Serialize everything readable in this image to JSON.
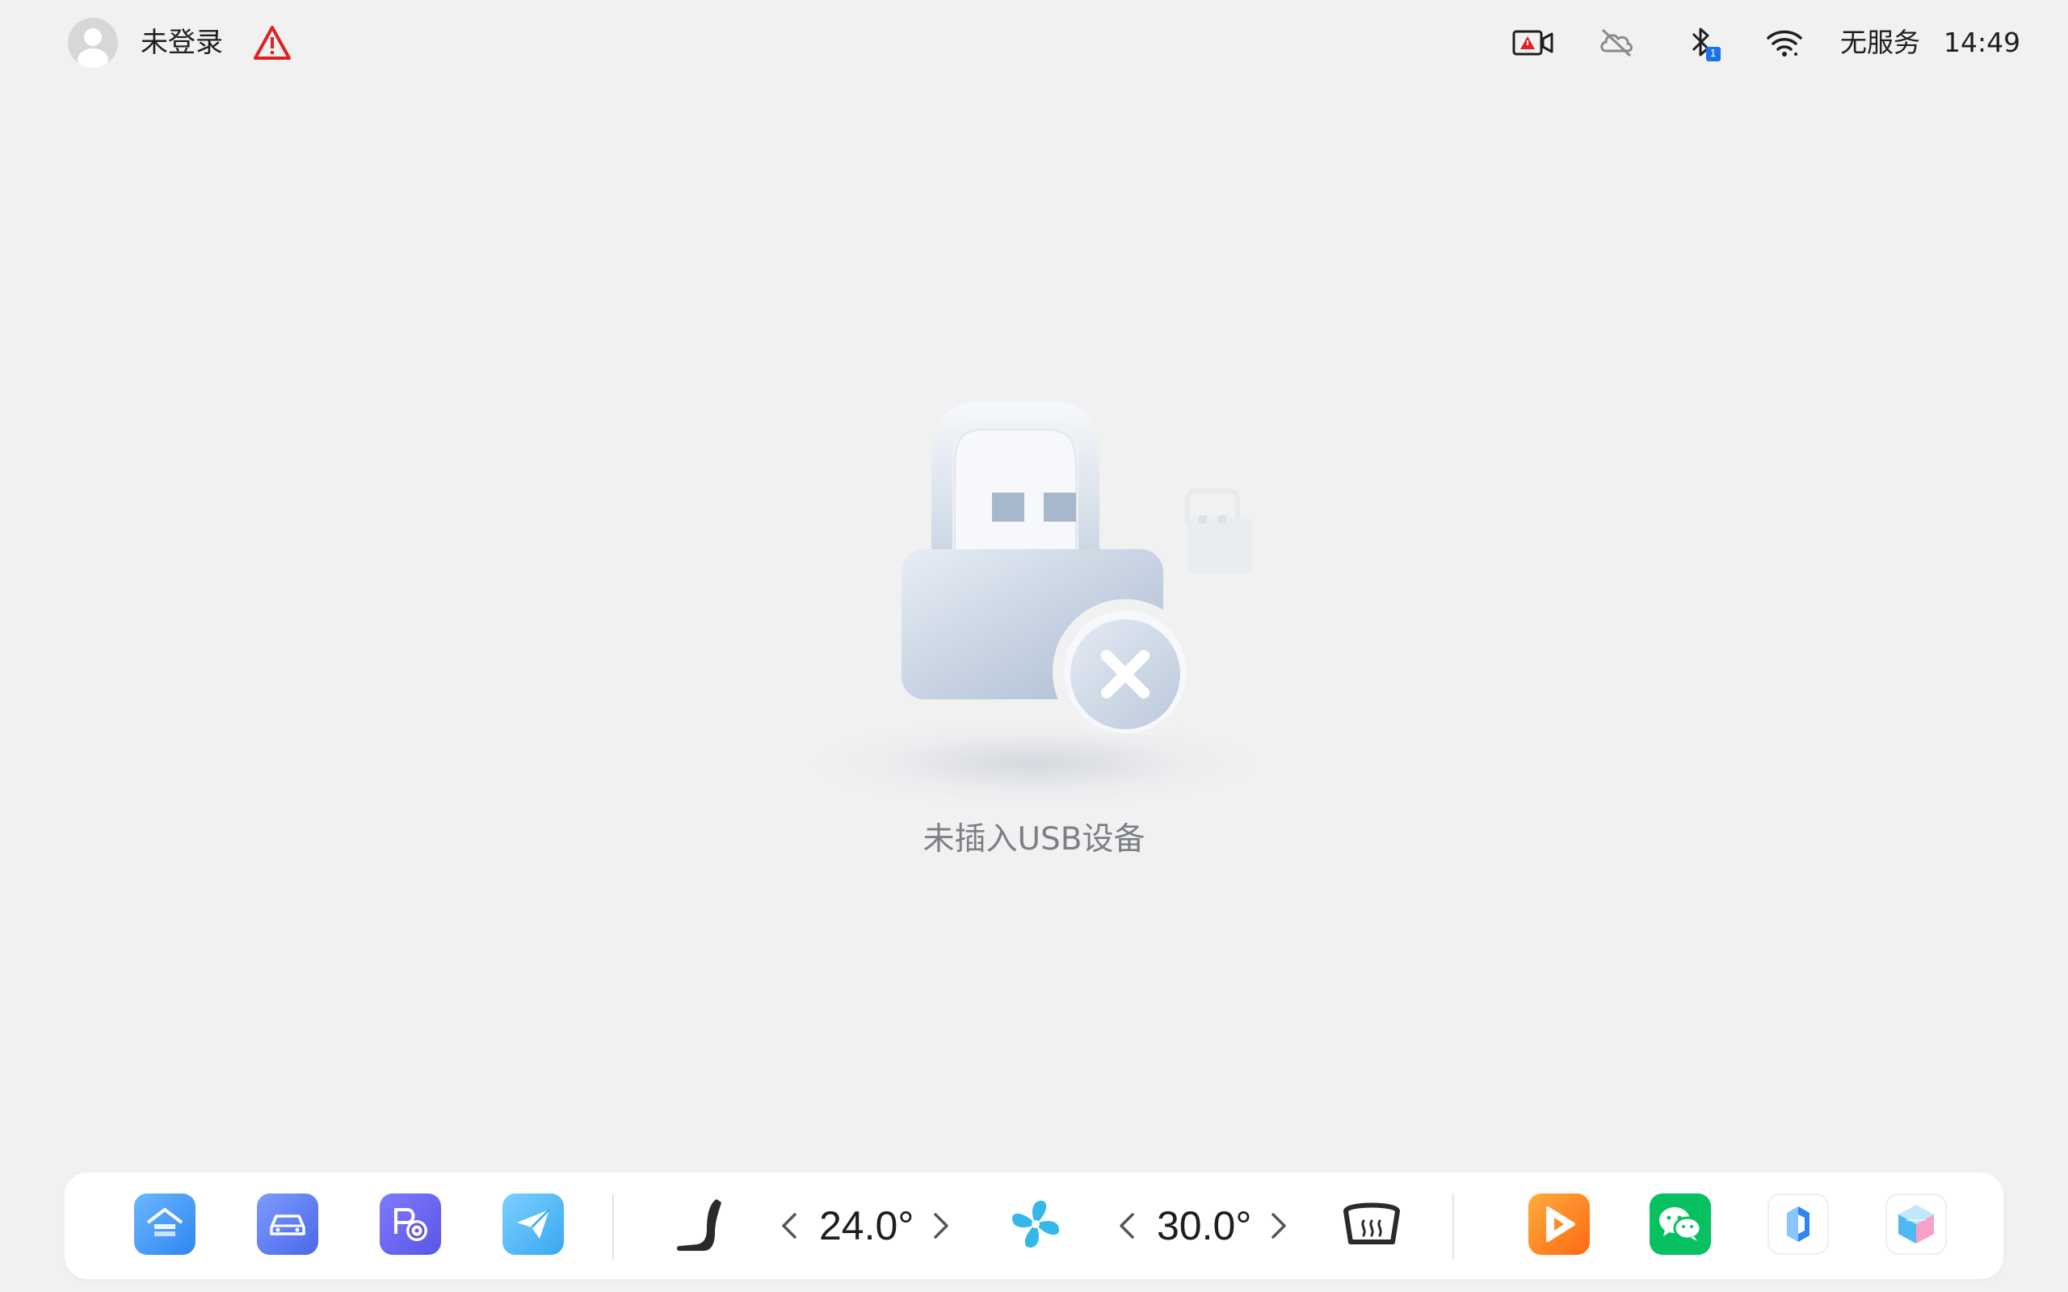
{
  "status_bar": {
    "login_status": "未登录",
    "network": "无服务",
    "time": "14:49",
    "bluetooth_badge": "1",
    "icons": [
      "avatar",
      "warning-icon",
      "dashcam-alert-icon",
      "cloud-off-icon",
      "bluetooth-icon",
      "wifi-icon"
    ]
  },
  "main": {
    "empty_message": "未插入USB设备",
    "illustration": "usb-not-connected"
  },
  "dock": {
    "left_apps": [
      "home-app-icon",
      "car-app-icon",
      "parking-app-icon",
      "navigation-app-icon"
    ],
    "climate": {
      "driver_temp": "24.0°",
      "passenger_temp": "30.0°",
      "icons": [
        "seat-icon",
        "fan-icon",
        "rear-defrost-icon"
      ]
    },
    "right_apps": [
      "video-app-icon",
      "wechat-app-icon",
      "app-store-icon",
      "cube-app-icon"
    ],
    "colors": {
      "wechat": "#07c160",
      "video": "#ff7a1a",
      "fan": "#35b8e8",
      "warning": "#e02020"
    }
  }
}
